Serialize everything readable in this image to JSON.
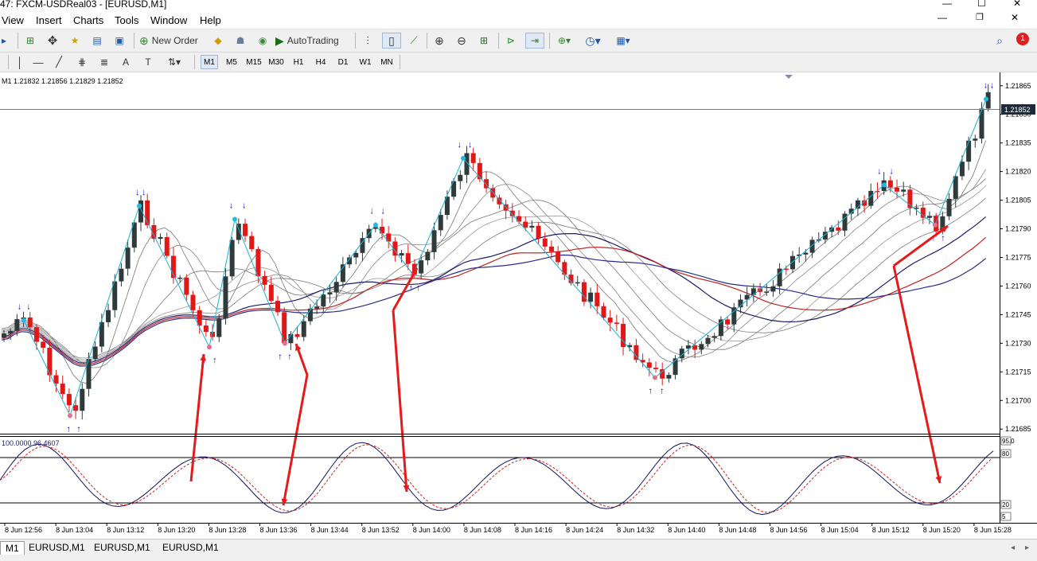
{
  "window": {
    "title": "47: FXCM-USDReal03 - [EURUSD,M1]",
    "minimize_glyph": "—",
    "maximize_glyph": "☐",
    "close_glyph": "✕"
  },
  "menu": [
    "View",
    "Insert",
    "Charts",
    "Tools",
    "Window",
    "Help"
  ],
  "toolbar": {
    "new_order_label": "New Order",
    "autotrading_label": "AutoTrading",
    "notification_count": "1"
  },
  "timeframes": [
    "M1",
    "M5",
    "M15",
    "M30",
    "H1",
    "H4",
    "D1",
    "W1",
    "MN"
  ],
  "active_timeframe": "M1",
  "chart": {
    "info_line": "M1  1.21832 1.21856 1.21829 1.21852",
    "current_price": "1.21852",
    "indicator_label": "100.0000 96.4607",
    "osc_levels": [
      "80",
      "20"
    ],
    "osc_edge_labels": [
      "95.0",
      "5"
    ]
  },
  "chart_data": {
    "type": "candlestick",
    "symbol": "EURUSD",
    "timeframe": "M1",
    "price_ticks": [
      "1.21865",
      "1.21850",
      "1.21835",
      "1.21820",
      "1.21805",
      "1.21790",
      "1.21775",
      "1.21760",
      "1.21745",
      "1.21730",
      "1.21715",
      "1.21700",
      "1.21685"
    ],
    "price_range": [
      1.21683,
      1.21872
    ],
    "time_ticks": [
      "8 Jun 12:56",
      "8 Jun 13:04",
      "8 Jun 13:12",
      "8 Jun 13:20",
      "8 Jun 13:28",
      "8 Jun 13:36",
      "8 Jun 13:44",
      "8 Jun 13:52",
      "8 Jun 14:00",
      "8 Jun 14:08",
      "8 Jun 14:16",
      "8 Jun 14:24",
      "8 Jun 14:32",
      "8 Jun 14:40",
      "8 Jun 14:48",
      "8 Jun 14:56",
      "8 Jun 15:04",
      "8 Jun 15:12",
      "8 Jun 15:20",
      "8 Jun 15:28"
    ],
    "zigzag_prices": [
      1.21742,
      1.21692,
      1.21802,
      1.21728,
      1.21795,
      1.2173,
      1.21792,
      1.21766,
      1.21827,
      1.21712,
      1.21813,
      1.21792,
      1.21858
    ],
    "oscillator_levels": [
      80,
      20
    ],
    "oscillator_range": [
      0,
      100
    ]
  },
  "tabs": [
    "M1",
    "EURUSD,M1",
    "EURUSD,M1",
    "EURUSD,M1"
  ],
  "active_tab": "M1",
  "colors": {
    "bull_candle": "#2f3b3b",
    "bear_candle": "#e01818",
    "zigzag": "#19b3d6",
    "arrow": "#1010c8",
    "annotation": "#e51a1a",
    "price_label_bg": "#1c2a3a"
  }
}
